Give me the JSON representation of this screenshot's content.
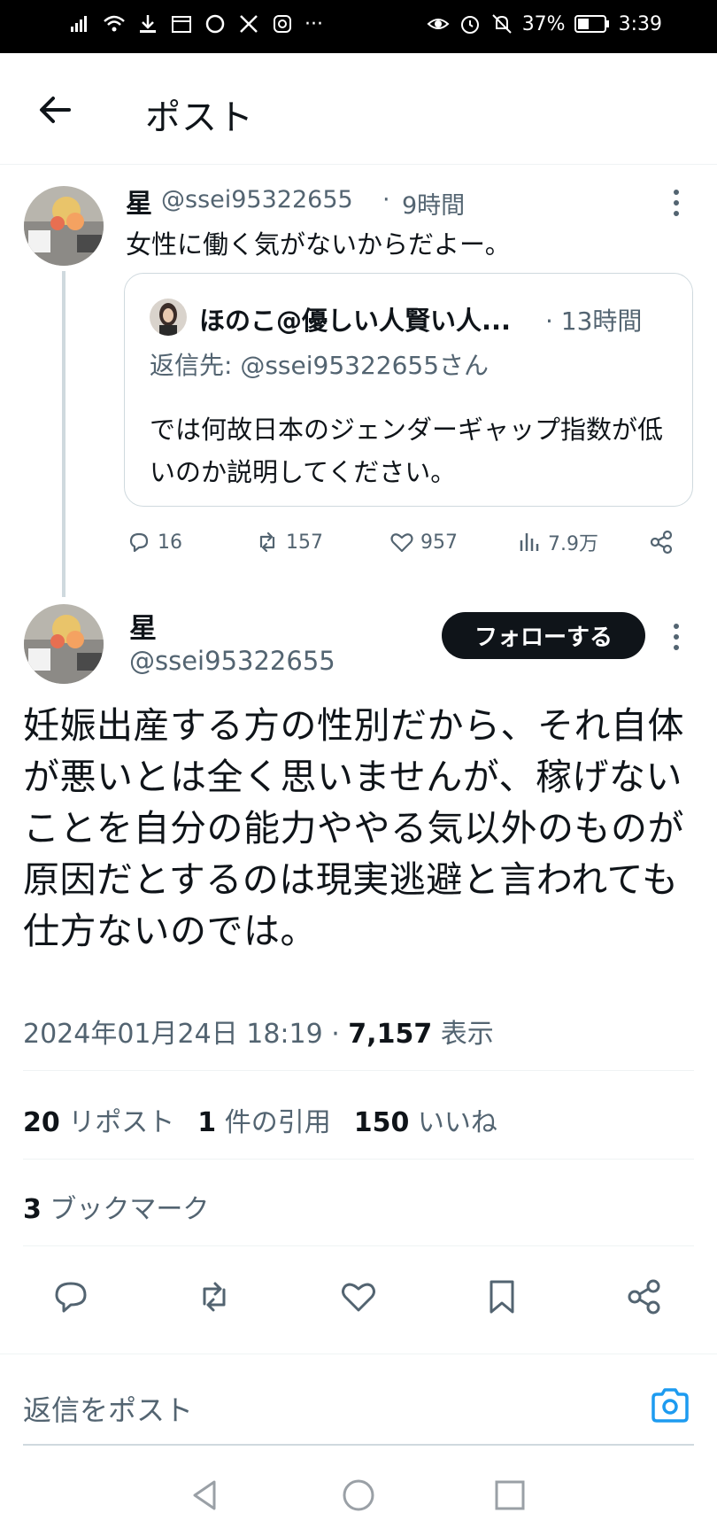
{
  "status_bar": {
    "battery_percent": "37%",
    "time": "3:39",
    "more": "···"
  },
  "header": {
    "title": "ポスト"
  },
  "post1": {
    "name": "星",
    "handle": "@ssei95322655",
    "separator": "·",
    "time": "9時間",
    "text": "女性に働く気がないからだよー。",
    "quote": {
      "name": "ほのこ@優しい人賢い人...",
      "time": "· 13時間",
      "reply_to": "返信先: @ssei95322655さん",
      "text": "では何故日本のジェンダーギャップ指数が低いのか説明してください。"
    },
    "actions": {
      "replies": "16",
      "reposts": "157",
      "likes": "957",
      "views": "7.9万"
    }
  },
  "post2": {
    "name": "星",
    "handle": "@ssei95322655",
    "follow_label": "フォローする",
    "text": "妊娠出産する方の性別だから、それ自体が悪いとは全く思いませんが、稼げないことを自分の能力ややる気以外のものが原因だとするのは現実逃避と言われても仕方ないのでは。",
    "timestamp": "2024年01月24日 18:19 · ",
    "views_count": "7,157",
    "views_label": " 表示",
    "stats": {
      "reposts_count": "20",
      "reposts_label": " リポスト",
      "quotes_count": "1",
      "quotes_label": " 件の引用",
      "likes_count": "150",
      "likes_label": " いいね"
    },
    "bookmarks_count": "3",
    "bookmarks_label": " ブックマーク"
  },
  "reply": {
    "placeholder": "返信をポスト"
  },
  "colors": {
    "text": "#0f1419",
    "muted": "#536471",
    "accent": "#1d9bf0",
    "border": "#eff3f4"
  },
  "icons": [
    "back-arrow-icon",
    "more-vertical-icon",
    "reply-icon",
    "repost-icon",
    "like-icon",
    "views-icon",
    "share-icon",
    "bookmark-icon",
    "camera-icon"
  ]
}
